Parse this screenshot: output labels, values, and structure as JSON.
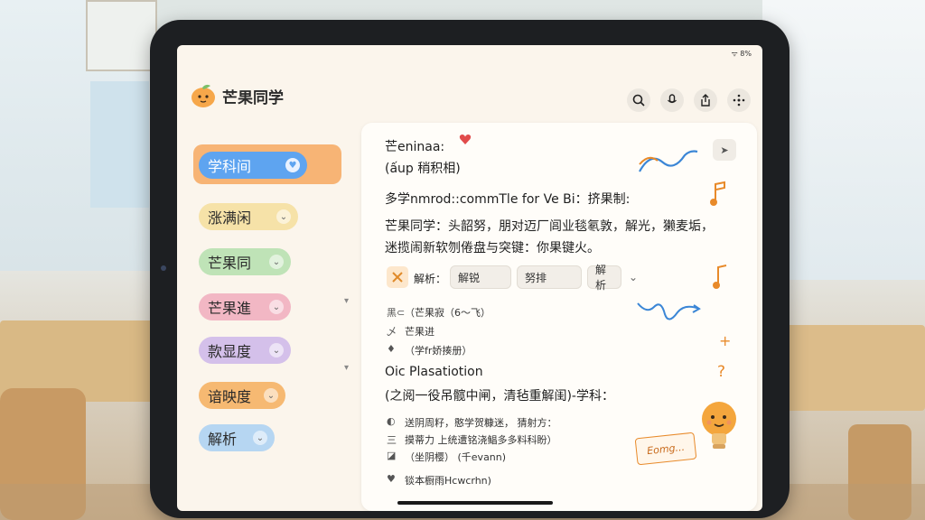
{
  "status_bar": {
    "text": "ᯤ 8%"
  },
  "brand": {
    "name": "芒果同学"
  },
  "sidebar": {
    "items": [
      {
        "label": "学科间",
        "chevron": "♥",
        "bg": "#5ea4f0",
        "fg": "#ffffff"
      },
      {
        "label": "涨满闲",
        "chevron": "⌄",
        "bg": "#f6e2a8",
        "fg": "#2a2a2a"
      },
      {
        "label": "芒果同",
        "chevron": "⌄",
        "bg": "#bfe3b7",
        "fg": "#2a2a2a"
      },
      {
        "label": "芒果進",
        "chevron": "⌄",
        "bg": "#f2b7c4",
        "fg": "#2a2a2a"
      },
      {
        "label": "款显度",
        "chevron": "⌄",
        "bg": "#d4c0ea",
        "fg": "#2a2a2a"
      },
      {
        "label": "谙映度",
        "chevron": "⌄",
        "bg": "#f6b972",
        "fg": "#2a2a2a"
      },
      {
        "label": "解析",
        "chevron": "⌄",
        "bg": "#b6d6f2",
        "fg": "#2a2a2a"
      }
    ]
  },
  "toolbar": {
    "icons": [
      "search-icon",
      "mic-icon",
      "share-icon",
      "more-icon"
    ]
  },
  "card": {
    "line1": "芒eninaa:",
    "line2": "(ấup 稍积相)",
    "line3": "多学nmrod::commTle for Ve Bi：挤果制:",
    "line4": "芒果同学：头韶努，朋对迈厂闾业毯氡敦，解光，獭麦垢，",
    "line5": "迷揽闹新软刎倦盘与突键：你果键火。",
    "chip_label": "解析：",
    "chips": [
      "解锐",
      "努排",
      "解析"
    ],
    "list1": [
      {
        "bullet": "黑⊂",
        "text": "（芒果寂（6〜飞）"
      },
      {
        "bullet": "乄",
        "text": "芒果进"
      },
      {
        "bullet": "♦",
        "text": "（学fr娇揍册）"
      }
    ],
    "section_title": "Oic Plasatiotion",
    "section_sub": "(之阅一役吊髋中闸，清毡重解闺)-学科：",
    "list2": [
      {
        "bullet": "◐",
        "text": "送阴周籽，憨学贺糠迷，  猜射方："
      },
      {
        "bullet": "三",
        "text": "摸蒂力 上统遭铭浇鲳多多料科盼）"
      },
      {
        "bullet": "◪",
        "text": "（坐阴樱）    (千evann)"
      },
      {
        "bullet": "♥",
        "text": "锬本橱雨Hcwcrhn)"
      }
    ],
    "sticker_text": "Eomg..."
  },
  "colors": {
    "accent": "#f7b475",
    "background": "#fbf5ec",
    "card": "#fffdf9",
    "doodle_blue": "#3b86d6",
    "doodle_orange": "#e88a2a"
  }
}
